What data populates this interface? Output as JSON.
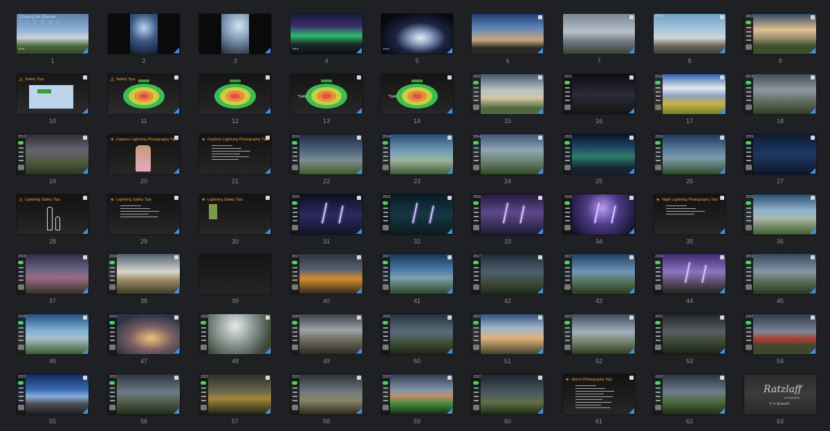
{
  "view": {
    "accent": "#3d8ff0",
    "background": "#1f2023"
  },
  "slides": [
    {
      "n": "1",
      "bg": "linear-gradient(180deg,#5d7fa8 0%,#8eb2d6 40%,#c9d4d7 60%,#4e6b3a 80%,#2f4626 100%)",
      "kind": "cover",
      "title": "Chasing the Elusive",
      "subtitle": "S T O R M S"
    },
    {
      "n": "2",
      "bg": "radial-gradient(circle at 50% 35%,#bcd3f2 0%,#3c5a86 30%,#0b1424 70%)",
      "kind": "photo",
      "pillar": true
    },
    {
      "n": "3",
      "bg": "radial-gradient(circle at 55% 30%,#d6e3f0 0%,#8aa3bd 25%,#26313c 65%)",
      "kind": "photo",
      "pillar": true
    },
    {
      "n": "4",
      "bg": "linear-gradient(180deg,#141d38 0%,#3e2a6c 30%,#2bbd6b 55%,#1f2a2e 75%,#0c0f12 100%)",
      "kind": "cover-dots"
    },
    {
      "n": "5",
      "bg": "radial-gradient(ellipse at 55% 60%,#e8ecf3 0%,#8a9cc2 20%,#1c2440 45%,#06080e 80%)",
      "kind": "cover-dots"
    },
    {
      "n": "6",
      "bg": "linear-gradient(180deg,#1f3c70 0%,#5d86b8 35%,#c9a77e 65%,#2d2a24 85%)",
      "kind": "photo"
    },
    {
      "n": "7",
      "bg": "linear-gradient(180deg,#7a8694 0%,#b9c1c9 45%,#6c7680 70%,#3b4030 100%)",
      "kind": "photo"
    },
    {
      "n": "8",
      "bg": "linear-gradient(180deg,#6ea0c6 0%,#a9c9dc 40%,#cfd6d8 60%,#6a6658 80%,#3c3a34 100%)",
      "kind": "photo",
      "year": "2009"
    },
    {
      "n": "9",
      "bg": "linear-gradient(180deg,#334a68 0%,#e0c08c 40%,#9a8f70 60%,#3b4f2a 80%)",
      "kind": "sidebar",
      "year": "2010"
    },
    {
      "n": "10",
      "bg": "linear-gradient(180deg,#161616 0%,#2b2b2b 100%)",
      "kind": "safety",
      "title": "Safety Tips",
      "diagram": "#bcd5ea"
    },
    {
      "n": "11",
      "bg": "linear-gradient(180deg,#161616 0%,#2b2b2b 100%)",
      "kind": "safety-radar",
      "title": "Safety Tips"
    },
    {
      "n": "12",
      "bg": "linear-gradient(180deg,#151515 0%,#262626 100%)",
      "kind": "radar"
    },
    {
      "n": "13",
      "bg": "linear-gradient(180deg,#151515 0%,#262626 100%)",
      "kind": "radar",
      "label": "\"Safe\""
    },
    {
      "n": "14",
      "bg": "linear-gradient(180deg,#151515 0%,#262626 100%)",
      "kind": "radar",
      "label": "\"Safe\""
    },
    {
      "n": "15",
      "bg": "linear-gradient(180deg,#41566e 0%,#b8c2c2 40%,#d6c7a2 60%,#4d6a3b 85%)",
      "kind": "sidebar",
      "year": "2011"
    },
    {
      "n": "16",
      "bg": "linear-gradient(180deg,#0b0c12 0%,#2a2a3a 50%,#151515 100%)",
      "kind": "sidebar",
      "year": "2012"
    },
    {
      "n": "17",
      "bg": "linear-gradient(180deg,#2c5fa8 0%,#e4e8ef 35%,#8aa4bf 55%,#c9b23c 75%,#6f7b2d 100%)",
      "kind": "sidebar",
      "year": "2013"
    },
    {
      "n": "18",
      "bg": "linear-gradient(180deg,#3f4a55 0%,#8d98a2 40%,#5d6a5a 70%,#2f3b27 100%)",
      "kind": "sidebar",
      "year": "2013"
    },
    {
      "n": "19",
      "bg": "linear-gradient(180deg,#2f2d36 0%,#6a6472 40%,#4e5a3b 70%,#2b3422 100%)",
      "kind": "sidebar",
      "year": "2013"
    },
    {
      "n": "20",
      "bg": "linear-gradient(180deg,#121212 0%,#262626 100%)",
      "kind": "tips-person",
      "title": "Daytime Lightning Photography Tips"
    },
    {
      "n": "21",
      "bg": "linear-gradient(180deg,#121212 0%,#262626 100%)",
      "kind": "tips",
      "title": "Daytime Lightning Photography Tips",
      "lines": 6
    },
    {
      "n": "22",
      "bg": "linear-gradient(180deg,#1e2a3c 0%,#4d6580 40%,#7d8e8e 65%,#3d5a2b 100%)",
      "kind": "sidebar",
      "year": "2014"
    },
    {
      "n": "23",
      "bg": "linear-gradient(180deg,#2a4b6e 0%,#6f9bb8 40%,#9fb39f 65%,#3c5c2f 100%)",
      "kind": "sidebar",
      "year": "2014"
    },
    {
      "n": "24",
      "bg": "linear-gradient(180deg,#3c5470 0%,#8fa6b8 40%,#6f8577 65%,#2f4a22 100%)",
      "kind": "sidebar",
      "year": "2014"
    },
    {
      "n": "25",
      "bg": "linear-gradient(180deg,#081426 0%,#1f4c6a 35%,#2c7d6c 55%,#152231 85%)",
      "kind": "sidebar",
      "year": "2015"
    },
    {
      "n": "26",
      "bg": "linear-gradient(180deg,#1e3553 0%,#5c7fa3 40%,#7f9aa8 60%,#2e4b28 100%)",
      "kind": "sidebar",
      "year": "2015"
    },
    {
      "n": "27",
      "bg": "linear-gradient(180deg,#0c1a34 0%,#1d3a63 50%,#0d1628 100%)",
      "kind": "sidebar",
      "year": "2015"
    },
    {
      "n": "28",
      "bg": "linear-gradient(180deg,#121212 0%,#262626 100%)",
      "kind": "stick",
      "title": "Lightning Safety Tips"
    },
    {
      "n": "29",
      "bg": "linear-gradient(180deg,#121212 0%,#262626 100%)",
      "kind": "tips",
      "title": "Lightning Safety Tips",
      "lines": 5
    },
    {
      "n": "30",
      "bg": "linear-gradient(180deg,#121212 0%,#262626 100%)",
      "kind": "tips-app",
      "title": "Lightning Safety Tips"
    },
    {
      "n": "31",
      "bg": "linear-gradient(180deg,#0b0f24 0%,#2b2a5e 50%,#12142a 100%)",
      "kind": "sidebar-bolt",
      "year": "2015"
    },
    {
      "n": "32",
      "bg": "linear-gradient(180deg,#0a1a26 0%,#163746 50%,#0b1c1c 100%)",
      "kind": "sidebar-bolt",
      "year": "2013"
    },
    {
      "n": "33",
      "bg": "linear-gradient(180deg,#221a3e 0%,#5c4a8c 45%,#201a36 100%)",
      "kind": "sidebar-bolt",
      "year": "2015"
    },
    {
      "n": "34",
      "bg": "radial-gradient(circle at 55% 35%,#b89bf2 0%,#4d3a86 35%,#141028 80%)",
      "kind": "sidebar-bolt",
      "year": "2016"
    },
    {
      "n": "35",
      "bg": "linear-gradient(180deg,#121212 0%,#262626 100%)",
      "kind": "tips",
      "title": "Night Lightning Photography Tips",
      "lines": 4
    },
    {
      "n": "36",
      "bg": "linear-gradient(180deg,#2a4c70 0%,#8fb3cf 40%,#aab7a7 60%,#3f5f2d 100%)",
      "kind": "sidebar",
      "year": "2016"
    },
    {
      "n": "37",
      "bg": "linear-gradient(180deg,#2c2c44 0%,#6e6486 40%,#9b6a84 60%,#2f3122 100%)",
      "kind": "sidebar",
      "year": "2016"
    },
    {
      "n": "38",
      "bg": "linear-gradient(180deg,#4e5e70 0%,#d8d8cc 45%,#9a8a63 65%,#3b3923 100%)",
      "kind": "sidebar",
      "year": "2016"
    },
    {
      "n": "39",
      "bg": "linear-gradient(180deg,#141414 0%,#252525 100%)",
      "kind": "blank"
    },
    {
      "n": "40",
      "bg": "linear-gradient(180deg,#2b3442 0%,#59646e 40%,#d48b2a 62%,#2c2a1c 100%)",
      "kind": "sidebar",
      "year": "2017"
    },
    {
      "n": "41",
      "bg": "linear-gradient(180deg,#173454 0%,#4a7aa6 40%,#7ea0b0 60%,#2a4620 100%)",
      "kind": "sidebar",
      "year": "2017"
    },
    {
      "n": "42",
      "bg": "linear-gradient(180deg,#1d2a34 0%,#4e6070 45%,#3f4c3c 70%,#1f2a18 100%)",
      "kind": "sidebar",
      "year": "2017"
    },
    {
      "n": "43",
      "bg": "linear-gradient(180deg,#213e60 0%,#6f97b8 45%,#56715a 70%,#26391b 100%)",
      "kind": "sidebar",
      "year": "2017"
    },
    {
      "n": "44",
      "bg": "linear-gradient(180deg,#3d2c6a 0%,#8c74c0 45%,#5c4c6c 70%,#1d2218 100%)",
      "kind": "sidebar-bolt",
      "year": "2018"
    },
    {
      "n": "45",
      "bg": "linear-gradient(180deg,#34475c 0%,#8798a8 45%,#5a6a55 70%,#2a3a1f 100%)",
      "kind": "sidebar",
      "year": "2019"
    },
    {
      "n": "46",
      "bg": "linear-gradient(180deg,#224d7c 0%,#7eb0d6 40%,#a6c1cc 60%,#3b5c2b 100%)",
      "kind": "sidebar",
      "year": "2019"
    },
    {
      "n": "47",
      "bg": "radial-gradient(ellipse at 60% 60%,#f0c27a 0%,#7a5e62 35%,#2b3448 70%)",
      "kind": "sidebar",
      "year": "2019"
    },
    {
      "n": "48",
      "bg": "radial-gradient(circle at 50% 30%,#e6eaea 0%,#8b9894 40%,#3d4838 80%)",
      "kind": "sidebar",
      "year": "2020"
    },
    {
      "n": "49",
      "bg": "linear-gradient(180deg,#3a3e46 0%,#9ea3aa 40%,#6b6a5c 65%,#2d2b22 100%)",
      "kind": "sidebar",
      "year": "2020"
    },
    {
      "n": "50",
      "bg": "linear-gradient(180deg,#26323e 0%,#5b6e7c 45%,#415038 70%,#1d2516 100%)",
      "kind": "sidebar",
      "year": "2020"
    },
    {
      "n": "51",
      "bg": "linear-gradient(180deg,#2f4f7c 0%,#9fb6cc 35%,#e2b27a 60%,#3d4428 100%)",
      "kind": "sidebar",
      "year": "2021"
    },
    {
      "n": "52",
      "bg": "linear-gradient(180deg,#3b4a5c 0%,#a2b0bb 45%,#71806a 70%,#2c3a20 100%)",
      "kind": "sidebar",
      "year": "2021"
    },
    {
      "n": "53",
      "bg": "linear-gradient(180deg,#22262c 0%,#5a5f62 45%,#3a4732 70%,#1a2212 100%)",
      "kind": "sidebar",
      "year": "2022"
    },
    {
      "n": "54",
      "bg": "linear-gradient(180deg,#2e3a4a 0%,#7a8899 45%,#b13a2e 62%,#3a4a2a 80%)",
      "kind": "sidebar",
      "year": "2022"
    },
    {
      "n": "55",
      "bg": "linear-gradient(180deg,#102a5a 0%,#3d6fb8 40%,#8ab0d8 55%,#4a4a50 75%,#1f1f22 100%)",
      "kind": "sidebar",
      "year": "2022"
    },
    {
      "n": "56",
      "bg": "linear-gradient(180deg,#2c3440 0%,#6e7c88 45%,#4e5c48 70%,#222c1a 100%)",
      "kind": "sidebar",
      "year": "2022"
    },
    {
      "n": "57",
      "bg": "linear-gradient(180deg,#2a2e2a 0%,#6d6a4c 45%,#a28a3a 60%,#1e2414 100%)",
      "kind": "sidebar",
      "year": "2022"
    },
    {
      "n": "58",
      "bg": "linear-gradient(180deg,#2a3038 0%,#737b80 45%,#8a8466 65%,#2c2a1c 100%)",
      "kind": "sidebar",
      "year": "2022"
    },
    {
      "n": "59",
      "bg": "linear-gradient(180deg,#2c3a50 0%,#8797ab 40%,#c28c6a 55%,#3c8a3a 75%,#1c2414 100%)",
      "kind": "sidebar",
      "year": "2022"
    },
    {
      "n": "60",
      "bg": "linear-gradient(180deg,#1d242c 0%,#4a5862 45%,#5e7046 70%,#1e2814 100%)",
      "kind": "sidebar",
      "year": "2022"
    },
    {
      "n": "61",
      "bg": "linear-gradient(180deg,#121212 0%,#262626 100%)",
      "kind": "tips",
      "title": "Storm Photography Tips",
      "lines": 9
    },
    {
      "n": "62",
      "bg": "linear-gradient(180deg,#28323c 0%,#6f7f8c 45%,#4c6a3c 70%,#1f2c16 100%)",
      "kind": "sidebar",
      "year": "2022"
    },
    {
      "n": "63",
      "bg": "linear-gradient(180deg,#2c2c2c 0%,#3b3b3b 50%,#2a2a2a 100%)",
      "kind": "signature",
      "signature": "Ratzlaff",
      "sig_sub": "photography",
      "handle": "Ⓞ ✉ @ratzlaff"
    }
  ]
}
